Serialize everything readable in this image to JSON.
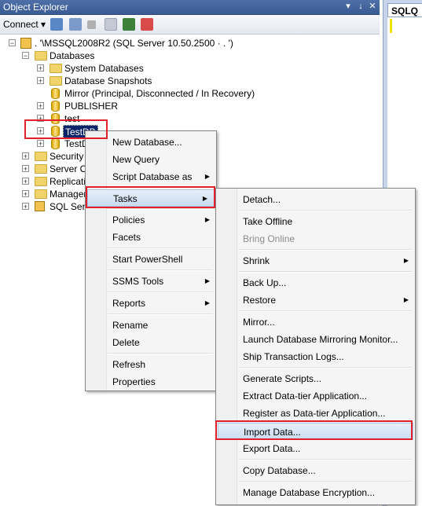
{
  "window": {
    "title": "Object Explorer"
  },
  "toolbar": {
    "connect_label": "Connect",
    "connect_arrow": "▾"
  },
  "tree": {
    "server_label": ".                     '\\MSSQL2008R2 (SQL Server 10.50.2500 ·  .                      ')",
    "databases": "Databases",
    "system_databases": "System Databases",
    "database_snapshots": "Database Snapshots",
    "mirror": "Mirror (Principal, Disconnected / In Recovery)",
    "publisher": "PUBLISHER",
    "test": "test",
    "testdb": "TestDB",
    "testd_partial": "TestD",
    "security": "Security",
    "server_objects": "Server Ol",
    "replication": "Replicatio",
    "management": "Managem",
    "sql_server_agent": "SQL Serve"
  },
  "right_panel": {
    "tab_label": "SQLQ"
  },
  "context_menu": {
    "items": [
      "New Database...",
      "New Query",
      "Script Database as",
      "Tasks",
      "Policies",
      "Facets",
      "Start PowerShell",
      "SSMS Tools",
      "Reports",
      "Rename",
      "Delete",
      "Refresh",
      "Properties"
    ]
  },
  "tasks_menu": {
    "items": [
      "Detach...",
      "Take Offline",
      "Bring Online",
      "Shrink",
      "Back Up...",
      "Restore",
      "Mirror...",
      "Launch Database Mirroring Monitor...",
      "Ship Transaction Logs...",
      "Generate Scripts...",
      "Extract Data-tier Application...",
      "Register as Data-tier Application...",
      "Import Data...",
      "Export Data...",
      "Copy Database...",
      "Manage Database Encryption..."
    ]
  },
  "glyphs": {
    "submenu_arrow": "▶",
    "expand": "+",
    "collapse": "−",
    "pin": "↓",
    "close": "✕"
  },
  "colors": {
    "highlight_border": "#e2202c",
    "selection": "#0a246a"
  }
}
